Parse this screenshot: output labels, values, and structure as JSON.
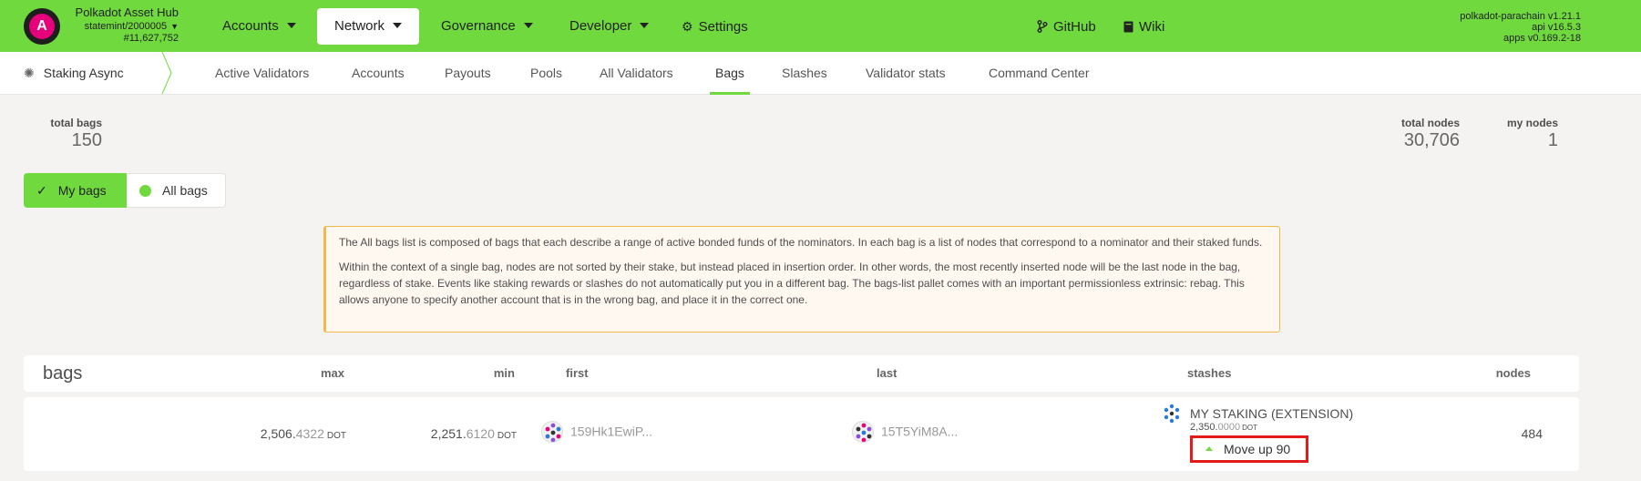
{
  "header": {
    "chain_name": "Polkadot Asset Hub",
    "chain_sub": "statemint/2000005",
    "block_number": "#11,627,752",
    "logo_letter": "A",
    "nav": [
      {
        "label": "Accounts",
        "has_dropdown": true
      },
      {
        "label": "Network",
        "has_dropdown": true,
        "active": true
      },
      {
        "label": "Governance",
        "has_dropdown": true
      },
      {
        "label": "Developer",
        "has_dropdown": true
      },
      {
        "label": "Settings",
        "icon": "gear-icon"
      },
      {
        "label": "GitHub",
        "icon": "git-branch-icon"
      },
      {
        "label": "Wiki",
        "icon": "book-icon"
      }
    ],
    "version": {
      "runtime": "polkadot-parachain v1.21.1",
      "api": "api v16.5.3",
      "apps": "apps v0.169.2-18"
    }
  },
  "subnav": {
    "section": "Staking Async",
    "tabs": [
      "Active Validators",
      "Accounts",
      "Payouts",
      "Pools",
      "All Validators",
      "Bags",
      "Slashes",
      "Validator stats",
      "Command Center"
    ],
    "active_tab": "Bags"
  },
  "summary": {
    "total_bags_label": "total bags",
    "total_bags_value": "150",
    "total_nodes_label": "total nodes",
    "total_nodes_value": "30,706",
    "my_nodes_label": "my nodes",
    "my_nodes_value": "1"
  },
  "toggle": {
    "my_bags": "My bags",
    "all_bags": "All bags",
    "selected": "My bags"
  },
  "info": {
    "p1": "The All bags list is composed of bags that each describe a range of active bonded funds of the nominators. In each bag is a list of nodes that correspond to a nominator and their staked funds.",
    "p2": "Within the context of a single bag, nodes are not sorted by their stake, but instead placed in insertion order. In other words, the most recently inserted node will be the last node in the bag, regardless of stake. Events like staking rewards or slashes do not automatically put you in a different bag. The bags-list pallet comes with an important permissionless extrinsic: rebag. This allows anyone to specify another account that is in the wrong bag, and place it in the correct one."
  },
  "table": {
    "title": "bags",
    "columns": {
      "max": "max",
      "min": "min",
      "first": "first",
      "last": "last",
      "stashes": "stashes",
      "nodes": "nodes"
    },
    "rows": [
      {
        "max_int": "2,506.",
        "max_dec": "4322",
        "min_int": "2,251.",
        "min_dec": "6120",
        "unit": "DOT",
        "first": "159Hk1EwiP...",
        "last": "15T5YiM8A...",
        "stash_name": "MY STAKING (EXTENSION)",
        "stash_int": "2,350.",
        "stash_dec": "0000",
        "move_label": "Move up 90",
        "nodes": "484"
      }
    ]
  }
}
